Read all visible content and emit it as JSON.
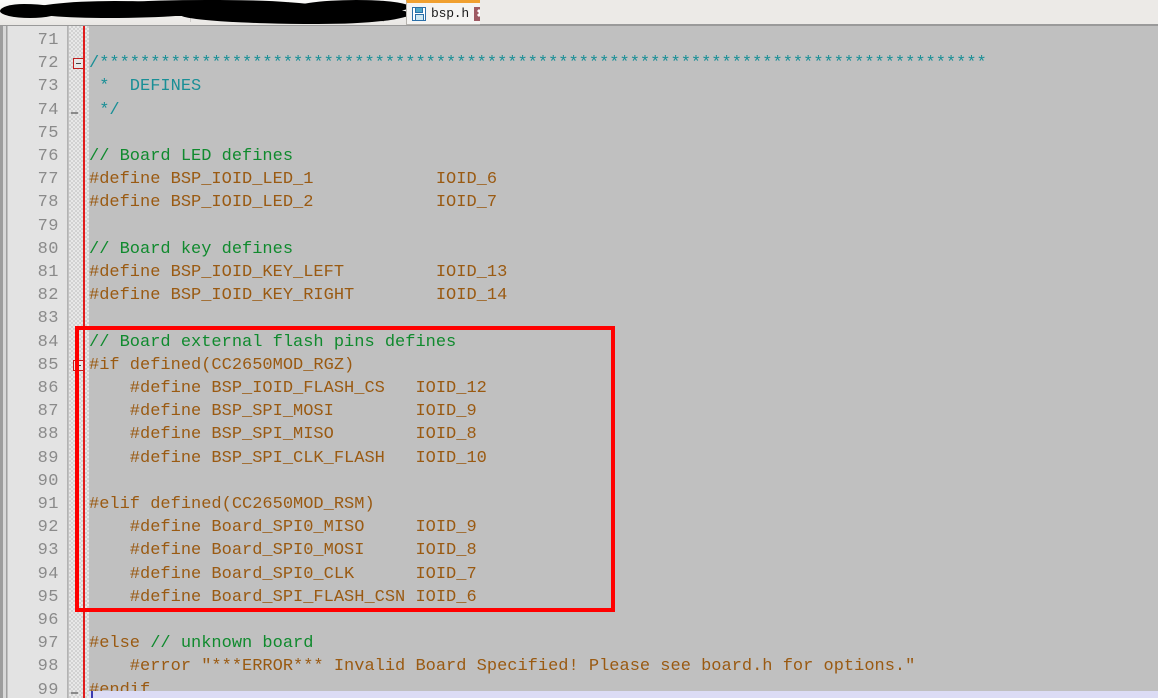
{
  "window": {
    "title": "bsp.h",
    "background_color": "#c0c0c0"
  },
  "toolbar": {
    "redacted": true,
    "redaction_label": "redacted-toolbar-region"
  },
  "tabs": [
    {
      "label": "bsp.h",
      "icon": "save-icon",
      "close_label": "✖",
      "active": true,
      "modified_accent_color": "#f0a030"
    }
  ],
  "editor": {
    "first_visible_line": 71,
    "last_visible_line": 99,
    "line_height_px": 23.2,
    "colors": {
      "background": "#c0c0c0",
      "gutter_background": "#e3e3e3",
      "line_number": "#8a8a8a",
      "block_comment": "#1a8f96",
      "line_comment": "#108a2e",
      "preprocessor": "#9a5a12",
      "change_bar": "#e01b1b",
      "annotation": "#ff0000",
      "current_line": "#dcdcf5"
    },
    "lines": [
      {
        "no": 71,
        "text": "",
        "cls": "tok-plain"
      },
      {
        "no": 72,
        "text": "/***************************************************************************************",
        "cls": "tok-blockcomment",
        "fold": "open"
      },
      {
        "no": 73,
        "text": " *  DEFINES",
        "cls": "tok-blockcomment"
      },
      {
        "no": 74,
        "text": " */",
        "cls": "tok-blockcomment",
        "fold": "tail"
      },
      {
        "no": 75,
        "text": "",
        "cls": "tok-plain"
      },
      {
        "no": 76,
        "text": "// Board LED defines",
        "cls": "tok-linecomment"
      },
      {
        "no": 77,
        "text": "#define BSP_IOID_LED_1            IOID_6",
        "cls": "tok-preproc"
      },
      {
        "no": 78,
        "text": "#define BSP_IOID_LED_2            IOID_7",
        "cls": "tok-preproc"
      },
      {
        "no": 79,
        "text": "",
        "cls": "tok-plain"
      },
      {
        "no": 80,
        "text": "// Board key defines",
        "cls": "tok-linecomment"
      },
      {
        "no": 81,
        "text": "#define BSP_IOID_KEY_LEFT         IOID_13",
        "cls": "tok-preproc"
      },
      {
        "no": 82,
        "text": "#define BSP_IOID_KEY_RIGHT        IOID_14",
        "cls": "tok-preproc"
      },
      {
        "no": 83,
        "text": "",
        "cls": "tok-plain"
      },
      {
        "no": 84,
        "text": "// Board external flash pins defines",
        "cls": "tok-linecomment"
      },
      {
        "no": 85,
        "text": "#if defined(CC2650MOD_RGZ)",
        "cls": "tok-preproc",
        "fold": "open"
      },
      {
        "no": 86,
        "text": "    #define BSP_IOID_FLASH_CS   IOID_12",
        "cls": "tok-preproc"
      },
      {
        "no": 87,
        "text": "    #define BSP_SPI_MOSI        IOID_9",
        "cls": "tok-preproc"
      },
      {
        "no": 88,
        "text": "    #define BSP_SPI_MISO        IOID_8",
        "cls": "tok-preproc"
      },
      {
        "no": 89,
        "text": "    #define BSP_SPI_CLK_FLASH   IOID_10",
        "cls": "tok-preproc"
      },
      {
        "no": 90,
        "text": "",
        "cls": "tok-plain"
      },
      {
        "no": 91,
        "text": "#elif defined(CC2650MOD_RSM)",
        "cls": "tok-preproc"
      },
      {
        "no": 92,
        "text": "    #define Board_SPI0_MISO     IOID_9",
        "cls": "tok-preproc"
      },
      {
        "no": 93,
        "text": "    #define Board_SPI0_MOSI     IOID_8",
        "cls": "tok-preproc"
      },
      {
        "no": 94,
        "text": "    #define Board_SPI0_CLK      IOID_7",
        "cls": "tok-preproc"
      },
      {
        "no": 95,
        "text": "    #define Board_SPI_FLASH_CSN IOID_6",
        "cls": "tok-preproc"
      },
      {
        "no": 96,
        "text": "",
        "cls": "tok-plain"
      },
      {
        "no": 97,
        "text": "#else // unknown board",
        "cls": "tok-preproc",
        "comment_from": 6
      },
      {
        "no": 98,
        "text": "    #error \"***ERROR*** Invalid Board Specified! Please see board.h for options.\"",
        "cls": "tok-preproc"
      },
      {
        "no": 99,
        "text": "#endif",
        "cls": "tok-preproc",
        "fold": "tail"
      }
    ],
    "annotation": {
      "name": "red-highlight-rectangle",
      "first_line": 84,
      "last_line": 95,
      "color": "#ff0000"
    }
  }
}
